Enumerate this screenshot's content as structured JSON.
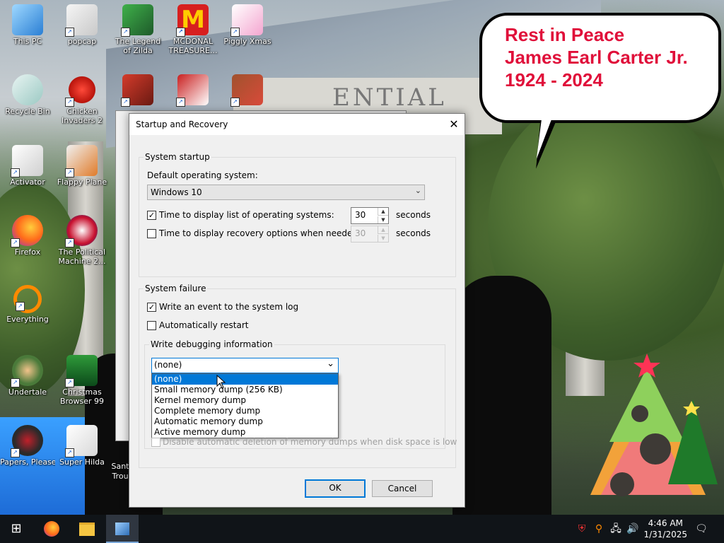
{
  "desktop": {
    "icons": [
      {
        "label": "This PC",
        "icon": "computer-icon"
      },
      {
        "label": "popcap",
        "icon": "popcap-icon"
      },
      {
        "label": "The Legend of Zilda",
        "icon": "game-icon"
      },
      {
        "label": "MCDONAL TREASURE...",
        "icon": "mcdonalds-icon"
      },
      {
        "label": "Piggly Xmas",
        "icon": "pig-icon"
      },
      {
        "label": "Recycle Bin",
        "icon": "recycle-bin-icon"
      },
      {
        "label": "Chicken Invaders 2",
        "icon": "chicken-icon"
      },
      {
        "label": "Activator",
        "icon": "activator-icon"
      },
      {
        "label": "Flappy Plane",
        "icon": "plane-icon"
      },
      {
        "label": "Firefox",
        "icon": "firefox-icon"
      },
      {
        "label": "The Political Machine 2...",
        "icon": "political-icon"
      },
      {
        "label": "Everything",
        "icon": "search-tool-icon"
      },
      {
        "label": "Undertale",
        "icon": "undertale-icon"
      },
      {
        "label": "Christmas Browser 99",
        "icon": "christmas-tree-icon"
      },
      {
        "label": "Papers, Please",
        "icon": "papers-please-icon"
      },
      {
        "label": "Super Hilda",
        "icon": "hilda-icon"
      },
      {
        "label": "Sant Trou",
        "icon": "santa-icon"
      }
    ],
    "bubble_lines": [
      "Rest in Peace",
      "James Earl Carter Jr.",
      "1924 - 2024"
    ],
    "building_text": "ENTIAL"
  },
  "dialog": {
    "title": "Startup and Recovery",
    "close_glyph": "✕",
    "system_startup": {
      "group_label": "System startup",
      "default_os_label": "Default operating system:",
      "default_os_value": "Windows 10",
      "time_list_label": "Time to display list of operating systems:",
      "time_list_checked": true,
      "time_list_value": "30",
      "time_recovery_label": "Time to display recovery options when needed:",
      "time_recovery_checked": false,
      "time_recovery_value": "30",
      "seconds": "seconds"
    },
    "system_failure": {
      "group_label": "System failure",
      "write_event_label": "Write an event to the system log",
      "write_event_checked": true,
      "auto_restart_label": "Automatically restart",
      "auto_restart_checked": false,
      "debug_group_label": "Write debugging information",
      "debug_selected": "(none)",
      "debug_options": [
        "(none)",
        "Small memory dump (256 KB)",
        "Kernel memory dump",
        "Complete memory dump",
        "Automatic memory dump",
        "Active memory dump"
      ],
      "disable_auto_delete_label": "Disable automatic deletion of memory dumps when disk space is low"
    },
    "ok_label": "OK",
    "cancel_label": "Cancel"
  },
  "taskbar": {
    "start_glyph": "⊞",
    "time": "4:46 AM",
    "date": "1/31/2025"
  }
}
